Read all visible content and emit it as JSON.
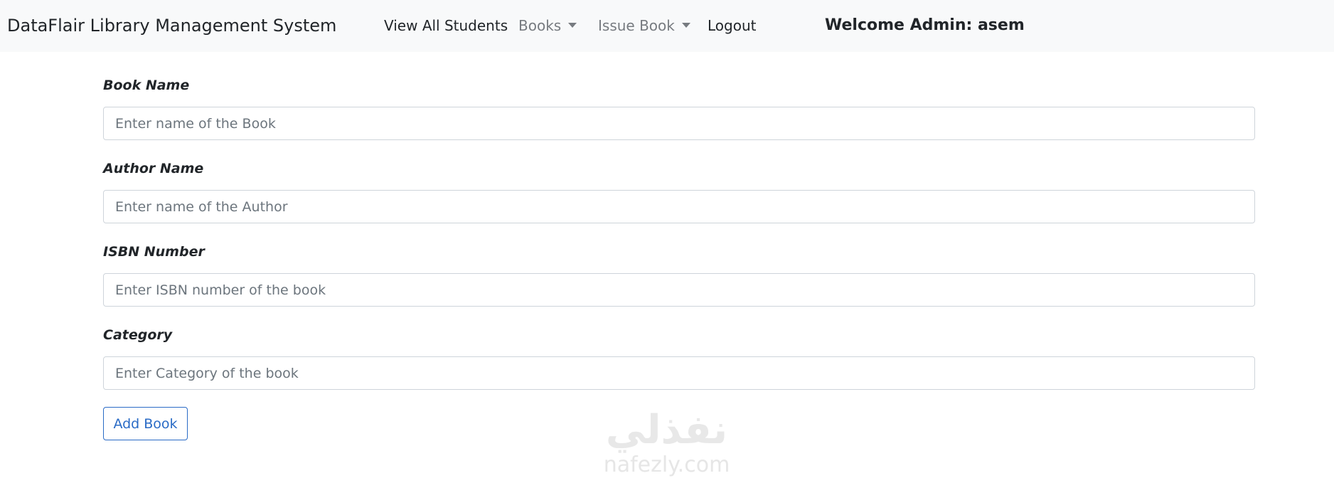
{
  "navbar": {
    "brand": "DataFlair Library Management System",
    "links": [
      {
        "label": "View All Students"
      },
      {
        "label": "Books"
      },
      {
        "label": "Issue Book"
      },
      {
        "label": "Logout"
      }
    ],
    "welcome": "Welcome Admin: asem"
  },
  "form": {
    "fields": [
      {
        "label": "Book Name",
        "placeholder": "Enter name of the Book"
      },
      {
        "label": "Author Name",
        "placeholder": "Enter name of the Author"
      },
      {
        "label": "ISBN Number",
        "placeholder": "Enter ISBN number of the book"
      },
      {
        "label": "Category",
        "placeholder": "Enter Category of the book"
      }
    ],
    "submit_label": "Add Book"
  },
  "watermark": {
    "logo_text": "نفذلي",
    "domain": "nafezly.com"
  },
  "colors": {
    "navbar_bg": "#f8f9fa",
    "primary": "#2a6bc6",
    "muted_link": "#777b80"
  }
}
